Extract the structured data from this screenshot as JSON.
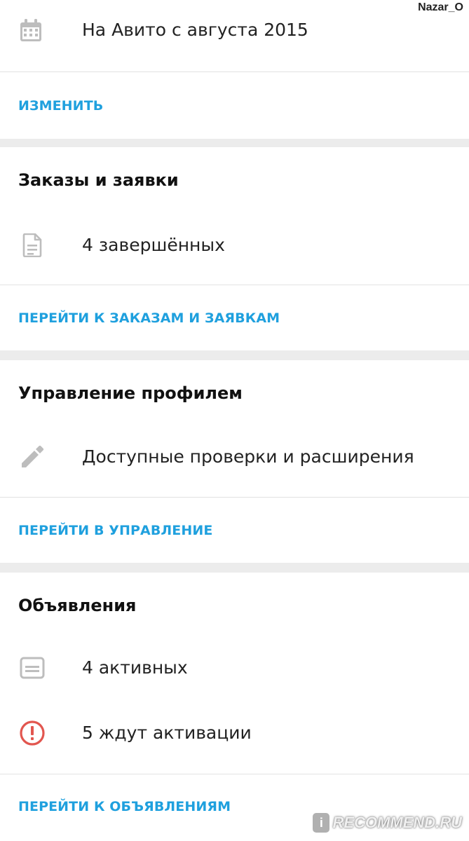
{
  "header_row": {
    "icon": "calendar-icon",
    "text": "На Авито с августа 2015",
    "action": "ИЗМЕНИТЬ"
  },
  "orders": {
    "title": "Заказы и заявки",
    "row": {
      "icon": "document-icon",
      "text": "4 завершённых"
    },
    "action": "ПЕРЕЙТИ К ЗАКАЗАМ И ЗАЯВКАМ"
  },
  "profile": {
    "title": "Управление профилем",
    "row": {
      "icon": "pencil-icon",
      "text": "Доступные проверки и расширения"
    },
    "action": "ПЕРЕЙТИ В УПРАВЛЕНИЕ"
  },
  "ads": {
    "title": "Объявления",
    "rows": [
      {
        "icon": "listing-icon",
        "text": "4 активных"
      },
      {
        "icon": "alert-icon",
        "text": "5 ждут активации"
      }
    ],
    "action": "ПЕРЕЙТИ К ОБЪЯВЛЕНИЯМ"
  },
  "overlay": {
    "username": "Nazar_O",
    "watermark": "RECOMMEND.RU",
    "watermark_badge": "i"
  },
  "colors": {
    "accent": "#1fa0de",
    "icon_gray": "#b8b8b8",
    "alert_red": "#e2564f",
    "background": "#ececec",
    "card": "#ffffff"
  }
}
